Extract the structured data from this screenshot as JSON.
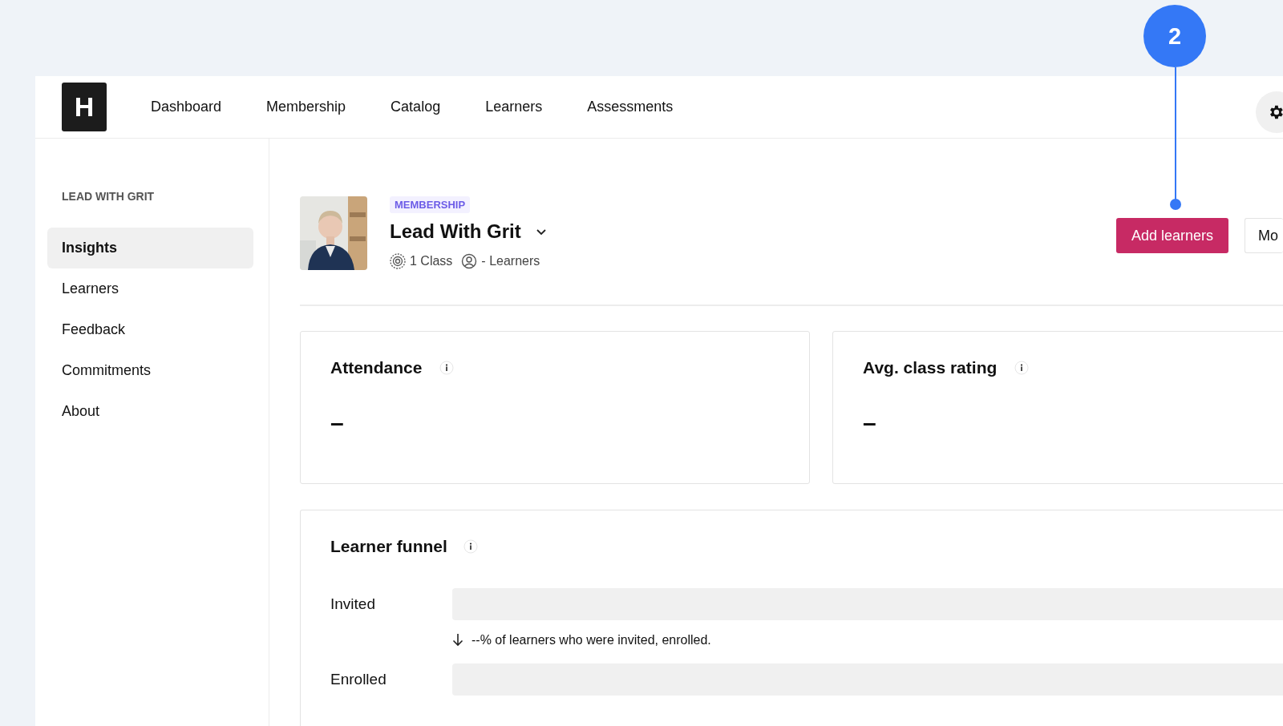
{
  "header": {
    "logo": "H",
    "nav": [
      {
        "label": "Dashboard"
      },
      {
        "label": "Membership"
      },
      {
        "label": "Catalog"
      },
      {
        "label": "Learners"
      },
      {
        "label": "Assessments"
      }
    ]
  },
  "sidebar": {
    "title": "LEAD WITH GRIT",
    "items": [
      {
        "label": "Insights",
        "selected": true
      },
      {
        "label": "Learners",
        "selected": false
      },
      {
        "label": "Feedback",
        "selected": false
      },
      {
        "label": "Commitments",
        "selected": false
      },
      {
        "label": "About",
        "selected": false
      }
    ]
  },
  "course": {
    "badge": "MEMBERSHIP",
    "title": "Lead With Grit",
    "classes": "1 Class",
    "learners": "- Learners"
  },
  "actions": [
    {
      "kind": "primary",
      "label": "Add learners"
    },
    {
      "kind": "secondary",
      "label": "Mo"
    }
  ],
  "stats": [
    {
      "title": "Attendance",
      "value": "–"
    },
    {
      "title": "Avg. class rating",
      "value": "–"
    }
  ],
  "funnel": {
    "title": "Learner funnel",
    "stages": [
      {
        "label": "Invited",
        "level": 0,
        "note": "--% of learners who were invited, enrolled."
      },
      {
        "label": "Enrolled",
        "level": 0
      }
    ]
  },
  "callout": {
    "number": "2"
  }
}
